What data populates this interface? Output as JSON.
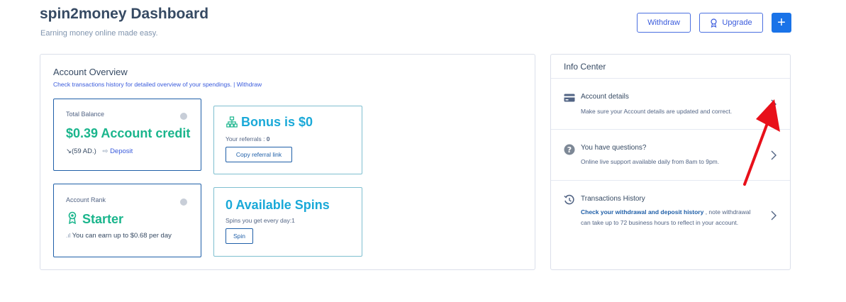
{
  "header": {
    "title": "spin2money Dashboard",
    "subtitle": "Earning money online made easy.",
    "withdraw_label": "Withdraw",
    "upgrade_label": "Upgrade",
    "add_label": "+"
  },
  "overview": {
    "title": "Account Overview",
    "subtitle": "Check transactions history for detailed overview of your spendings. | Withdraw",
    "balance": {
      "label": "Total Balance",
      "value": "$0.39 Account credit",
      "ad_count": "↘(59 AD.)",
      "deposit_label": "Deposit"
    },
    "bonus": {
      "title": "Bonus is $0",
      "referrals_label": "Your referrals : ",
      "referrals_value": "0",
      "button": "Copy referral link"
    },
    "rank": {
      "label": "Account Rank",
      "value": "Starter",
      "note": "You can earn up to $0.68 per day"
    },
    "spins": {
      "title": "0 Available Spins",
      "per_day_label": "Spins you get every day:",
      "per_day_value": "1",
      "button": "Spin"
    }
  },
  "info_center": {
    "title": "Info Center",
    "rows": [
      {
        "title": "Account details",
        "desc": "Make sure your Account details are updated and correct."
      },
      {
        "title": "You have questions?",
        "desc": "Online live support available daily from 8am to 9pm."
      },
      {
        "title": "Transactions History",
        "desc_link": "Check your withdrawal and deposit history",
        "desc": " , note withdrawal can take up to 72 business hours to reflect in your account."
      }
    ]
  },
  "colors": {
    "accent_blue": "#1a73e8",
    "green": "#1ab58c",
    "teal": "#1aa9d8",
    "annotation_red": "#e8101a"
  },
  "icons": [
    "ribbon-icon",
    "plus-icon",
    "sitemap-icon",
    "award-icon",
    "card-icon",
    "question-icon",
    "history-icon",
    "chevron-right-icon",
    "arrow-annotation"
  ]
}
